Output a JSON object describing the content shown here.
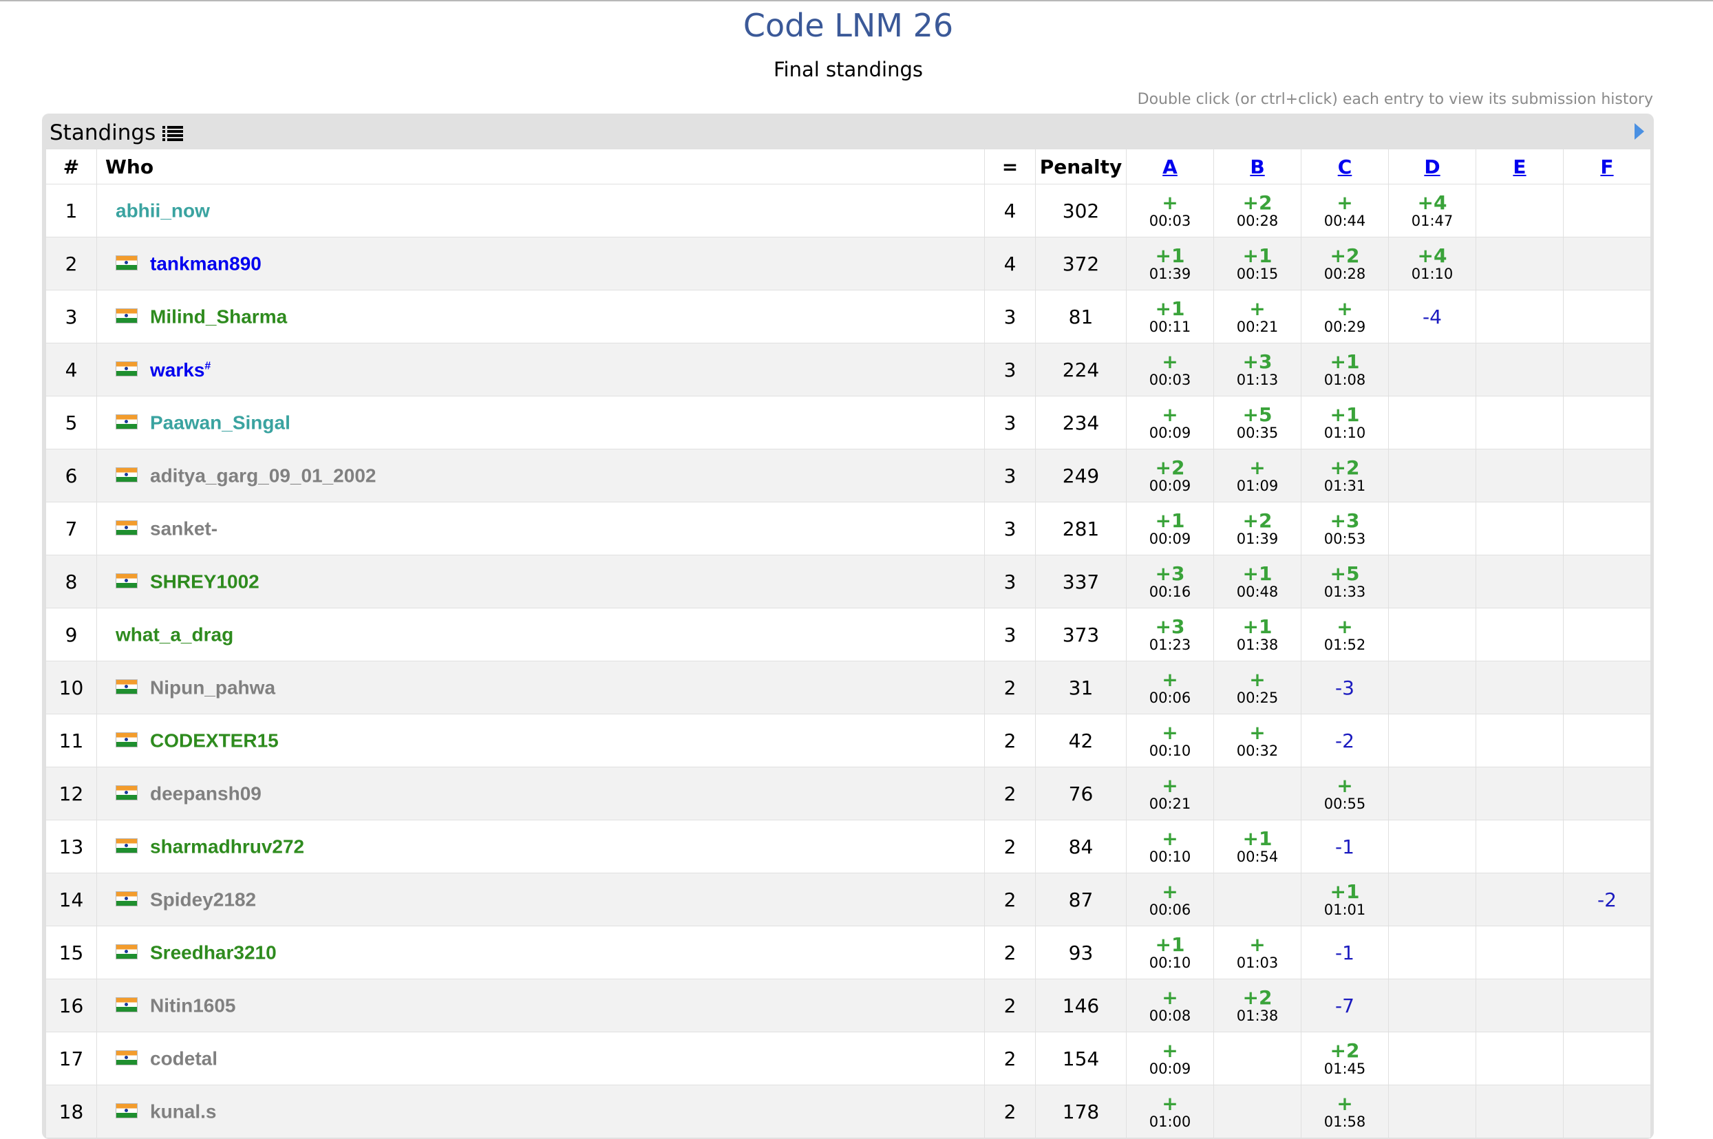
{
  "contest_title": "Code LNM 26",
  "subtitle": "Final standings",
  "hint": "Double click (or ctrl+click) each entry to view its submission history",
  "panel_title": "Standings",
  "header": {
    "rank": "#",
    "who": "Who",
    "solved": "=",
    "penalty": "Penalty",
    "problems": [
      "A",
      "B",
      "C",
      "D",
      "E",
      "F"
    ]
  },
  "colors": {
    "title": "#3b5998",
    "accepted": "#3aa33a",
    "rejected": "#1a1abf",
    "rank_cyan": "#3aa3a0",
    "rank_blue": "#0000ee",
    "rank_green": "#2e8b1e",
    "rank_gray": "#808080"
  },
  "rows": [
    {
      "rank": "1",
      "handle": "abhii_now",
      "flag": false,
      "color": "#3aa3a0",
      "mark": "",
      "solved": "4",
      "penalty": "302",
      "cells": [
        {
          "p": "+",
          "t": "00:03"
        },
        {
          "p": "+2",
          "t": "00:28"
        },
        {
          "p": "+",
          "t": "00:44"
        },
        {
          "p": "+4",
          "t": "01:47"
        },
        {},
        {}
      ]
    },
    {
      "rank": "2",
      "handle": "tankman890",
      "flag": true,
      "color": "#0000ee",
      "mark": "",
      "solved": "4",
      "penalty": "372",
      "cells": [
        {
          "p": "+1",
          "t": "01:39"
        },
        {
          "p": "+1",
          "t": "00:15"
        },
        {
          "p": "+2",
          "t": "00:28"
        },
        {
          "p": "+4",
          "t": "01:10"
        },
        {},
        {}
      ]
    },
    {
      "rank": "3",
      "handle": "Milind_Sharma",
      "flag": true,
      "color": "#2e8b1e",
      "mark": "",
      "solved": "3",
      "penalty": "81",
      "cells": [
        {
          "p": "+1",
          "t": "00:11"
        },
        {
          "p": "+",
          "t": "00:21"
        },
        {
          "p": "+",
          "t": "00:29"
        },
        {
          "m": "-4"
        },
        {},
        {}
      ]
    },
    {
      "rank": "4",
      "handle": "warks",
      "flag": true,
      "color": "#0000ee",
      "mark": "#",
      "solved": "3",
      "penalty": "224",
      "cells": [
        {
          "p": "+",
          "t": "00:03"
        },
        {
          "p": "+3",
          "t": "01:13"
        },
        {
          "p": "+1",
          "t": "01:08"
        },
        {},
        {},
        {}
      ]
    },
    {
      "rank": "5",
      "handle": "Paawan_Singal",
      "flag": true,
      "color": "#3aa3a0",
      "mark": "",
      "solved": "3",
      "penalty": "234",
      "cells": [
        {
          "p": "+",
          "t": "00:09"
        },
        {
          "p": "+5",
          "t": "00:35"
        },
        {
          "p": "+1",
          "t": "01:10"
        },
        {},
        {},
        {}
      ]
    },
    {
      "rank": "6",
      "handle": "aditya_garg_09_01_2002",
      "flag": true,
      "color": "#808080",
      "mark": "",
      "solved": "3",
      "penalty": "249",
      "cells": [
        {
          "p": "+2",
          "t": "00:09"
        },
        {
          "p": "+",
          "t": "01:09"
        },
        {
          "p": "+2",
          "t": "01:31"
        },
        {},
        {},
        {}
      ]
    },
    {
      "rank": "7",
      "handle": "sanket-",
      "flag": true,
      "color": "#808080",
      "mark": "",
      "solved": "3",
      "penalty": "281",
      "cells": [
        {
          "p": "+1",
          "t": "00:09"
        },
        {
          "p": "+2",
          "t": "01:39"
        },
        {
          "p": "+3",
          "t": "00:53"
        },
        {},
        {},
        {}
      ]
    },
    {
      "rank": "8",
      "handle": "SHREY1002",
      "flag": true,
      "color": "#2e8b1e",
      "mark": "",
      "solved": "3",
      "penalty": "337",
      "cells": [
        {
          "p": "+3",
          "t": "00:16"
        },
        {
          "p": "+1",
          "t": "00:48"
        },
        {
          "p": "+5",
          "t": "01:33"
        },
        {},
        {},
        {}
      ]
    },
    {
      "rank": "9",
      "handle": "what_a_drag",
      "flag": false,
      "color": "#2e8b1e",
      "mark": "",
      "solved": "3",
      "penalty": "373",
      "cells": [
        {
          "p": "+3",
          "t": "01:23"
        },
        {
          "p": "+1",
          "t": "01:38"
        },
        {
          "p": "+",
          "t": "01:52"
        },
        {},
        {},
        {}
      ]
    },
    {
      "rank": "10",
      "handle": "Nipun_pahwa",
      "flag": true,
      "color": "#808080",
      "mark": "",
      "solved": "2",
      "penalty": "31",
      "cells": [
        {
          "p": "+",
          "t": "00:06"
        },
        {
          "p": "+",
          "t": "00:25"
        },
        {
          "m": "-3"
        },
        {},
        {},
        {}
      ]
    },
    {
      "rank": "11",
      "handle": "CODEXTER15",
      "flag": true,
      "color": "#2e8b1e",
      "mark": "",
      "solved": "2",
      "penalty": "42",
      "cells": [
        {
          "p": "+",
          "t": "00:10"
        },
        {
          "p": "+",
          "t": "00:32"
        },
        {
          "m": "-2"
        },
        {},
        {},
        {}
      ]
    },
    {
      "rank": "12",
      "handle": "deepansh09",
      "flag": true,
      "color": "#808080",
      "mark": "",
      "solved": "2",
      "penalty": "76",
      "cells": [
        {
          "p": "+",
          "t": "00:21"
        },
        {},
        {
          "p": "+",
          "t": "00:55"
        },
        {},
        {},
        {}
      ]
    },
    {
      "rank": "13",
      "handle": "sharmadhruv272",
      "flag": true,
      "color": "#2e8b1e",
      "mark": "",
      "solved": "2",
      "penalty": "84",
      "cells": [
        {
          "p": "+",
          "t": "00:10"
        },
        {
          "p": "+1",
          "t": "00:54"
        },
        {
          "m": "-1"
        },
        {},
        {},
        {}
      ]
    },
    {
      "rank": "14",
      "handle": "Spidey2182",
      "flag": true,
      "color": "#808080",
      "mark": "",
      "solved": "2",
      "penalty": "87",
      "cells": [
        {
          "p": "+",
          "t": "00:06"
        },
        {},
        {
          "p": "+1",
          "t": "01:01"
        },
        {},
        {},
        {
          "m": "-2"
        }
      ]
    },
    {
      "rank": "15",
      "handle": "Sreedhar3210",
      "flag": true,
      "color": "#2e8b1e",
      "mark": "",
      "solved": "2",
      "penalty": "93",
      "cells": [
        {
          "p": "+1",
          "t": "00:10"
        },
        {
          "p": "+",
          "t": "01:03"
        },
        {
          "m": "-1"
        },
        {},
        {},
        {}
      ]
    },
    {
      "rank": "16",
      "handle": "Nitin1605",
      "flag": true,
      "color": "#808080",
      "mark": "",
      "solved": "2",
      "penalty": "146",
      "cells": [
        {
          "p": "+",
          "t": "00:08"
        },
        {
          "p": "+2",
          "t": "01:38"
        },
        {
          "m": "-7"
        },
        {},
        {},
        {}
      ]
    },
    {
      "rank": "17",
      "handle": "codetal",
      "flag": true,
      "color": "#808080",
      "mark": "",
      "solved": "2",
      "penalty": "154",
      "cells": [
        {
          "p": "+",
          "t": "00:09"
        },
        {},
        {
          "p": "+2",
          "t": "01:45"
        },
        {},
        {},
        {}
      ]
    },
    {
      "rank": "18",
      "handle": "kunal.s",
      "flag": true,
      "color": "#808080",
      "mark": "",
      "solved": "2",
      "penalty": "178",
      "cells": [
        {
          "p": "+",
          "t": "01:00"
        },
        {},
        {
          "p": "+",
          "t": "01:58"
        },
        {},
        {},
        {}
      ]
    }
  ]
}
